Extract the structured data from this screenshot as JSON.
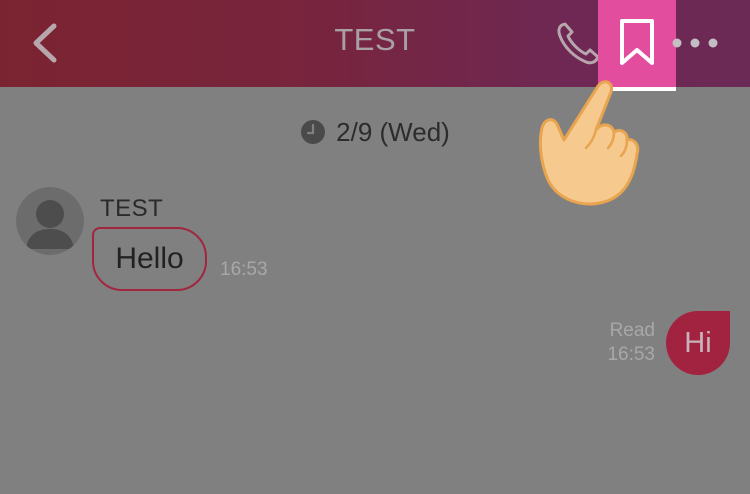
{
  "header": {
    "title": "TEST",
    "icons": {
      "back": "chevron-left-icon",
      "phone": "phone-icon",
      "bookmark": "bookmark-icon",
      "more": "more-dots-icon"
    },
    "highlight_color": "#e24d9e"
  },
  "chat": {
    "date": "2/9 (Wed)",
    "incoming": {
      "sender": "TEST",
      "text": "Hello",
      "time": "16:53"
    },
    "outgoing": {
      "text": "Hi",
      "status": "Read",
      "time": "16:53"
    }
  },
  "colors": {
    "header_start": "#7b2431",
    "header_end": "#6b2955",
    "accent": "#a12340",
    "background": "#808080"
  }
}
